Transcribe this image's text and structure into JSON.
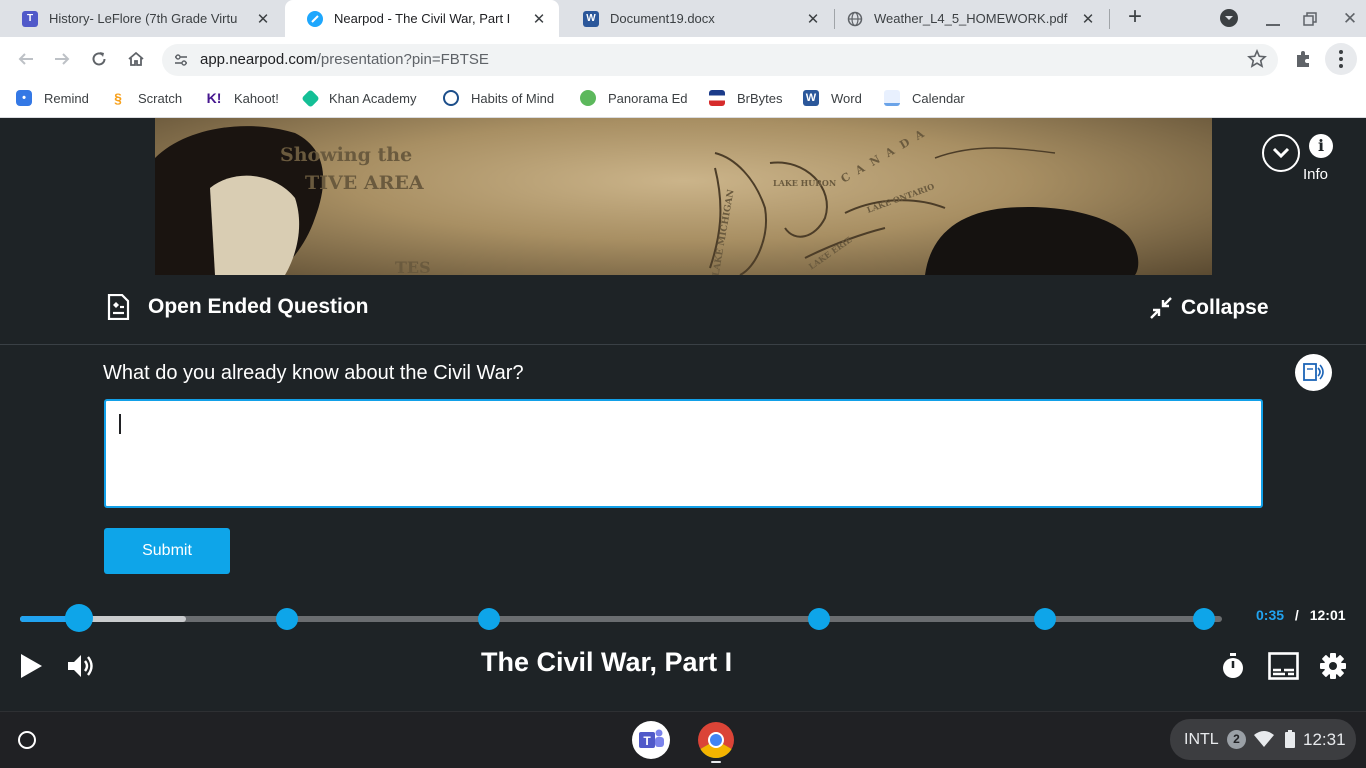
{
  "browser": {
    "tabs": [
      {
        "title": "History- LeFlore (7th Grade Virtu",
        "icon": "teams-icon",
        "active": false
      },
      {
        "title": "Nearpod - The Civil War, Part I",
        "icon": "nearpod-icon",
        "active": true
      },
      {
        "title": "Document19.docx",
        "icon": "word-icon",
        "active": false
      },
      {
        "title": "Weather_L4_5_HOMEWORK.pdf",
        "icon": "globe-icon",
        "active": false
      }
    ],
    "url_host": "app.nearpod.com",
    "url_path": "/presentation?pin=FBTSE",
    "bookmarks": [
      {
        "label": "Remind",
        "icon": "remind-icon"
      },
      {
        "label": "Scratch",
        "icon": "scratch-icon"
      },
      {
        "label": "Kahoot!",
        "icon": "kahoot-icon"
      },
      {
        "label": "Khan Academy",
        "icon": "khan-academy-icon"
      },
      {
        "label": "Habits of Mind",
        "icon": "habits-of-mind-icon"
      },
      {
        "label": "Panorama Ed",
        "icon": "panorama-icon"
      },
      {
        "label": "BrBytes",
        "icon": "brbytes-icon"
      },
      {
        "label": "Word",
        "icon": "word-icon"
      },
      {
        "label": "Calendar",
        "icon": "calendar-icon"
      }
    ]
  },
  "video_frame": {
    "map_labels": [
      "Showing the",
      "TIVE AREA",
      "TES",
      "LAKE MICHIGAN",
      "LAKE HURON",
      "CANADA",
      "LAKE ONTARIO",
      "LAKE ERIE"
    ]
  },
  "info_label": "Info",
  "question": {
    "type_label": "Open Ended Question",
    "collapse_label": "Collapse",
    "prompt": "What do you already know about the Civil War?",
    "answer_value": "",
    "submit_label": "Submit"
  },
  "player": {
    "current_time": "0:35",
    "separator": "/",
    "duration": "12:01",
    "title": "The Civil War, Part I",
    "progress_fraction": 0.049,
    "buffered_fraction": 0.138,
    "question_markers_fraction": [
      0.222,
      0.39,
      0.665,
      0.853,
      0.985
    ]
  },
  "shelf": {
    "keyboard_layout": "INTL",
    "notification_count": "2",
    "clock": "12:31",
    "apps": [
      "teams-icon",
      "chrome-icon"
    ]
  },
  "colors": {
    "accent": "#0ea5e9",
    "panel_bg": "#1e2326",
    "tab_strip": "#dee1e6"
  }
}
